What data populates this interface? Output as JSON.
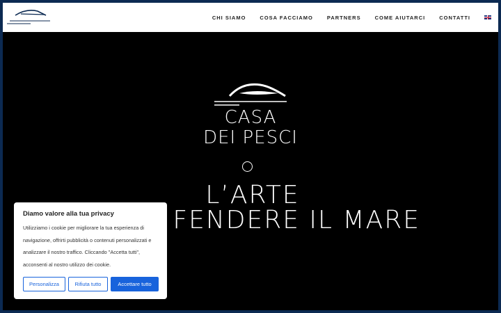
{
  "nav": {
    "items": [
      {
        "label": "CHI SIAMO"
      },
      {
        "label": "COSA FACCIAMO"
      },
      {
        "label": "PARTNERS"
      },
      {
        "label": "COME AIUTARCI"
      },
      {
        "label": "CONTATTI"
      }
    ],
    "language_icon": "uk-flag-icon"
  },
  "hero": {
    "brand_line1": "CASA",
    "brand_line2": "DEI PESCI",
    "tagline_line1": "L’ARTE",
    "tagline_line2": "FENDERE IL MARE"
  },
  "cookie_banner": {
    "title": "Diamo valore alla tua privacy",
    "text": "Utilizziamo i cookie per migliorare la tua esperienza di navigazione, offrirti pubblicità o contenuti personalizzati e analizzare il nostro traffico. Cliccando \"Accetta tutti\", acconsenti al nostro utilizzo dei cookie.",
    "customize_label": "Personalizza",
    "reject_label": "Rifiuta tutto",
    "accept_label": "Accettare tutto"
  },
  "colors": {
    "frame": "#0c2a52",
    "accent": "#1863dc",
    "hero_bg": "#000000"
  }
}
